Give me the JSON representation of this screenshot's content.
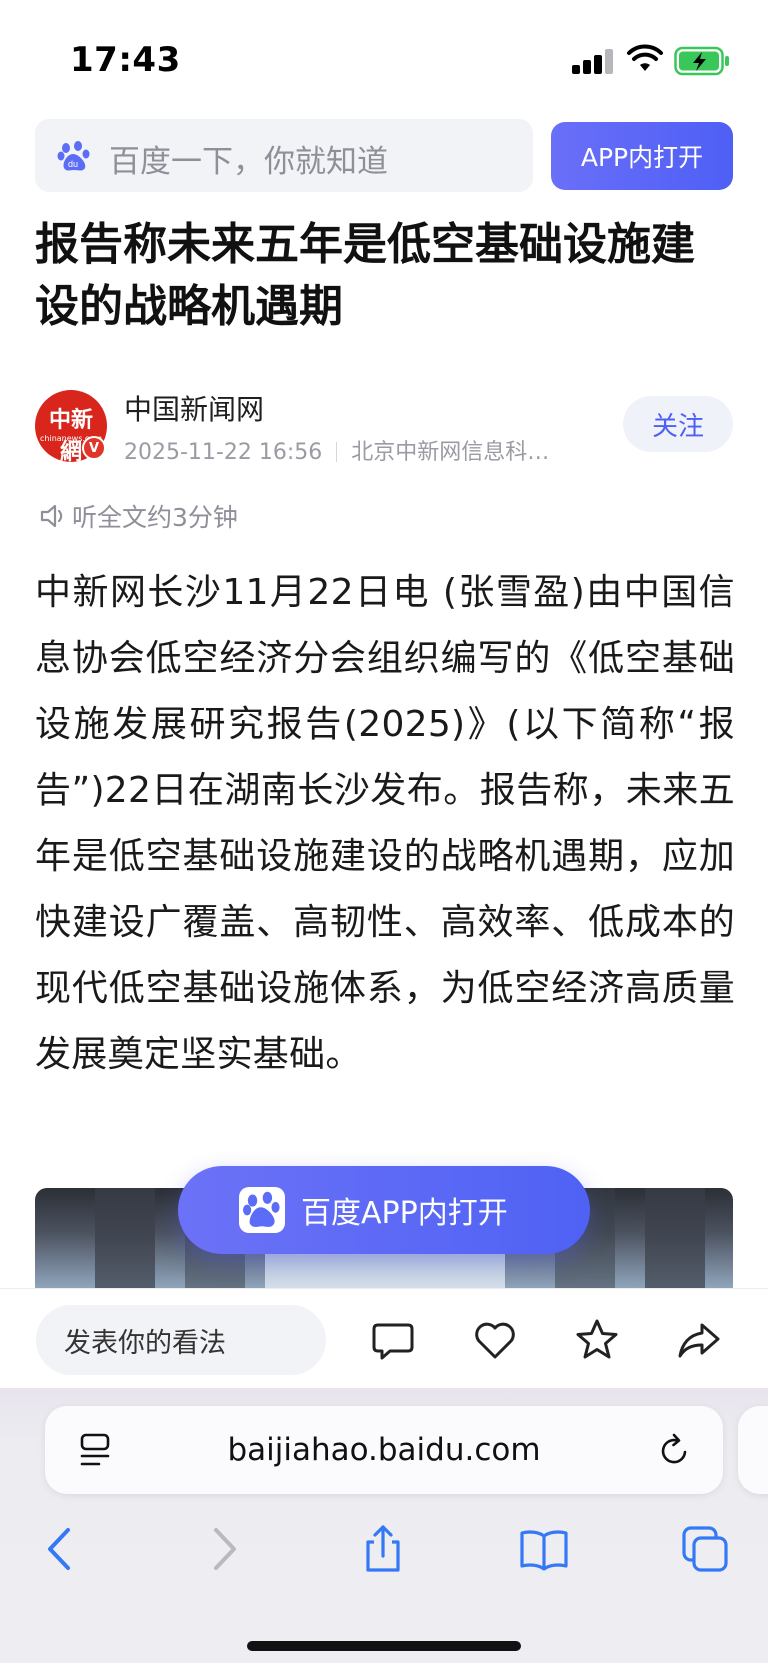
{
  "status_bar": {
    "time": "17:43"
  },
  "search": {
    "placeholder": "百度一下，你就知道",
    "open_app_label": "APP内打开"
  },
  "article": {
    "title": "报告称未来五年是低空基础设施建设的战略机遇期",
    "author": {
      "name": "中国新闻网",
      "logo_text": "中新網",
      "logo_sub": "chinanews.com",
      "date": "2025-11-22 16:56",
      "source": "北京中新网信息科…",
      "follow_label": "关注"
    },
    "listen_label": "听全文约3分钟",
    "body": "中新网长沙11月22日电 (张雪盈)由中国信息协会低空经济分会组织编写的《低空基础设施发展研究报告(2025)》(以下简称“报告”)22日在湖南长沙发布。报告称，未来五年是低空基础设施建设的战略机遇期，应加快建设广覆盖、高韧性、高效率、低成本的现代低空基础设施体系，为低空经济高质量发展奠定坚实基础。"
  },
  "float_button": {
    "label": "百度APP内打开"
  },
  "comment_bar": {
    "placeholder": "发表你的看法"
  },
  "safari": {
    "url": "baijiahao.baidu.com"
  },
  "colors": {
    "accent": "#4e5ff6",
    "brand_red": "#d9261c"
  }
}
